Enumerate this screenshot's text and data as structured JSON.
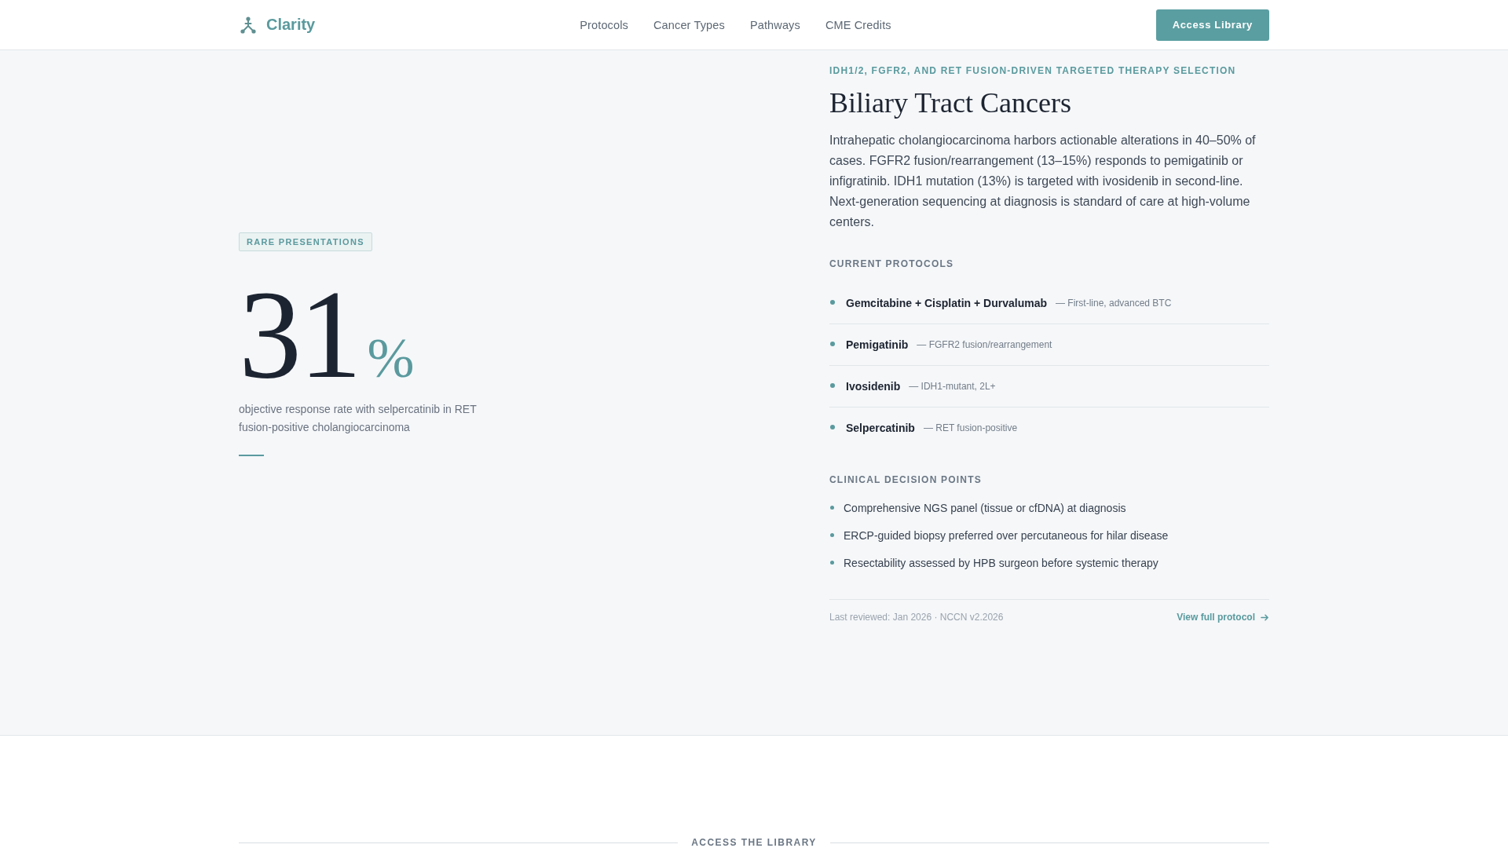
{
  "header": {
    "brand": "Clarity",
    "nav": [
      "Protocols",
      "Cancer Types",
      "Pathways",
      "CME Credits"
    ],
    "cta": "Access Library"
  },
  "stat": {
    "badge": "RARE PRESENTATIONS",
    "value": "31",
    "unit": "%",
    "caption": "objective response rate with selpercatinib in RET fusion-positive cholangiocarcinoma"
  },
  "detail": {
    "eyebrow": "IDH1/2, FGFR2, AND RET FUSION-DRIVEN TARGETED THERAPY SELECTION",
    "title": "Biliary Tract Cancers",
    "description": "Intrahepatic cholangiocarcinoma harbors actionable alterations in 40–50% of cases. FGFR2 fusion/rearrangement (13–15%) responds to pemigatinib or infigratinib. IDH1 mutation (13%) is targeted with ivosidenib in second-line. Next-generation sequencing at diagnosis is standard of care at high-volume centers.",
    "protocols": {
      "heading": "CURRENT PROTOCOLS",
      "items": [
        {
          "name": "Gemcitabine + Cisplatin + Durvalumab",
          "note": "— First-line, advanced BTC"
        },
        {
          "name": "Pemigatinib",
          "note": "— FGFR2 fusion/rearrangement"
        },
        {
          "name": "Ivosidenib",
          "note": "— IDH1-mutant, 2L+"
        },
        {
          "name": "Selpercatinib",
          "note": "— RET fusion-positive"
        }
      ]
    },
    "decision_points": {
      "heading": "CLINICAL DECISION POINTS",
      "items": [
        "Comprehensive NGS panel (tissue or cfDNA) at diagnosis",
        "ERCP-guided biopsy preferred over percutaneous for hilar disease",
        "Resectability assessed by HPB surgeon before systemic therapy"
      ]
    },
    "footer": {
      "meta": "Last reviewed: Jan 2026 · NCCN v2.2026",
      "link": "View full protocol"
    }
  },
  "library": {
    "heading": "ACCESS THE LIBRARY"
  }
}
